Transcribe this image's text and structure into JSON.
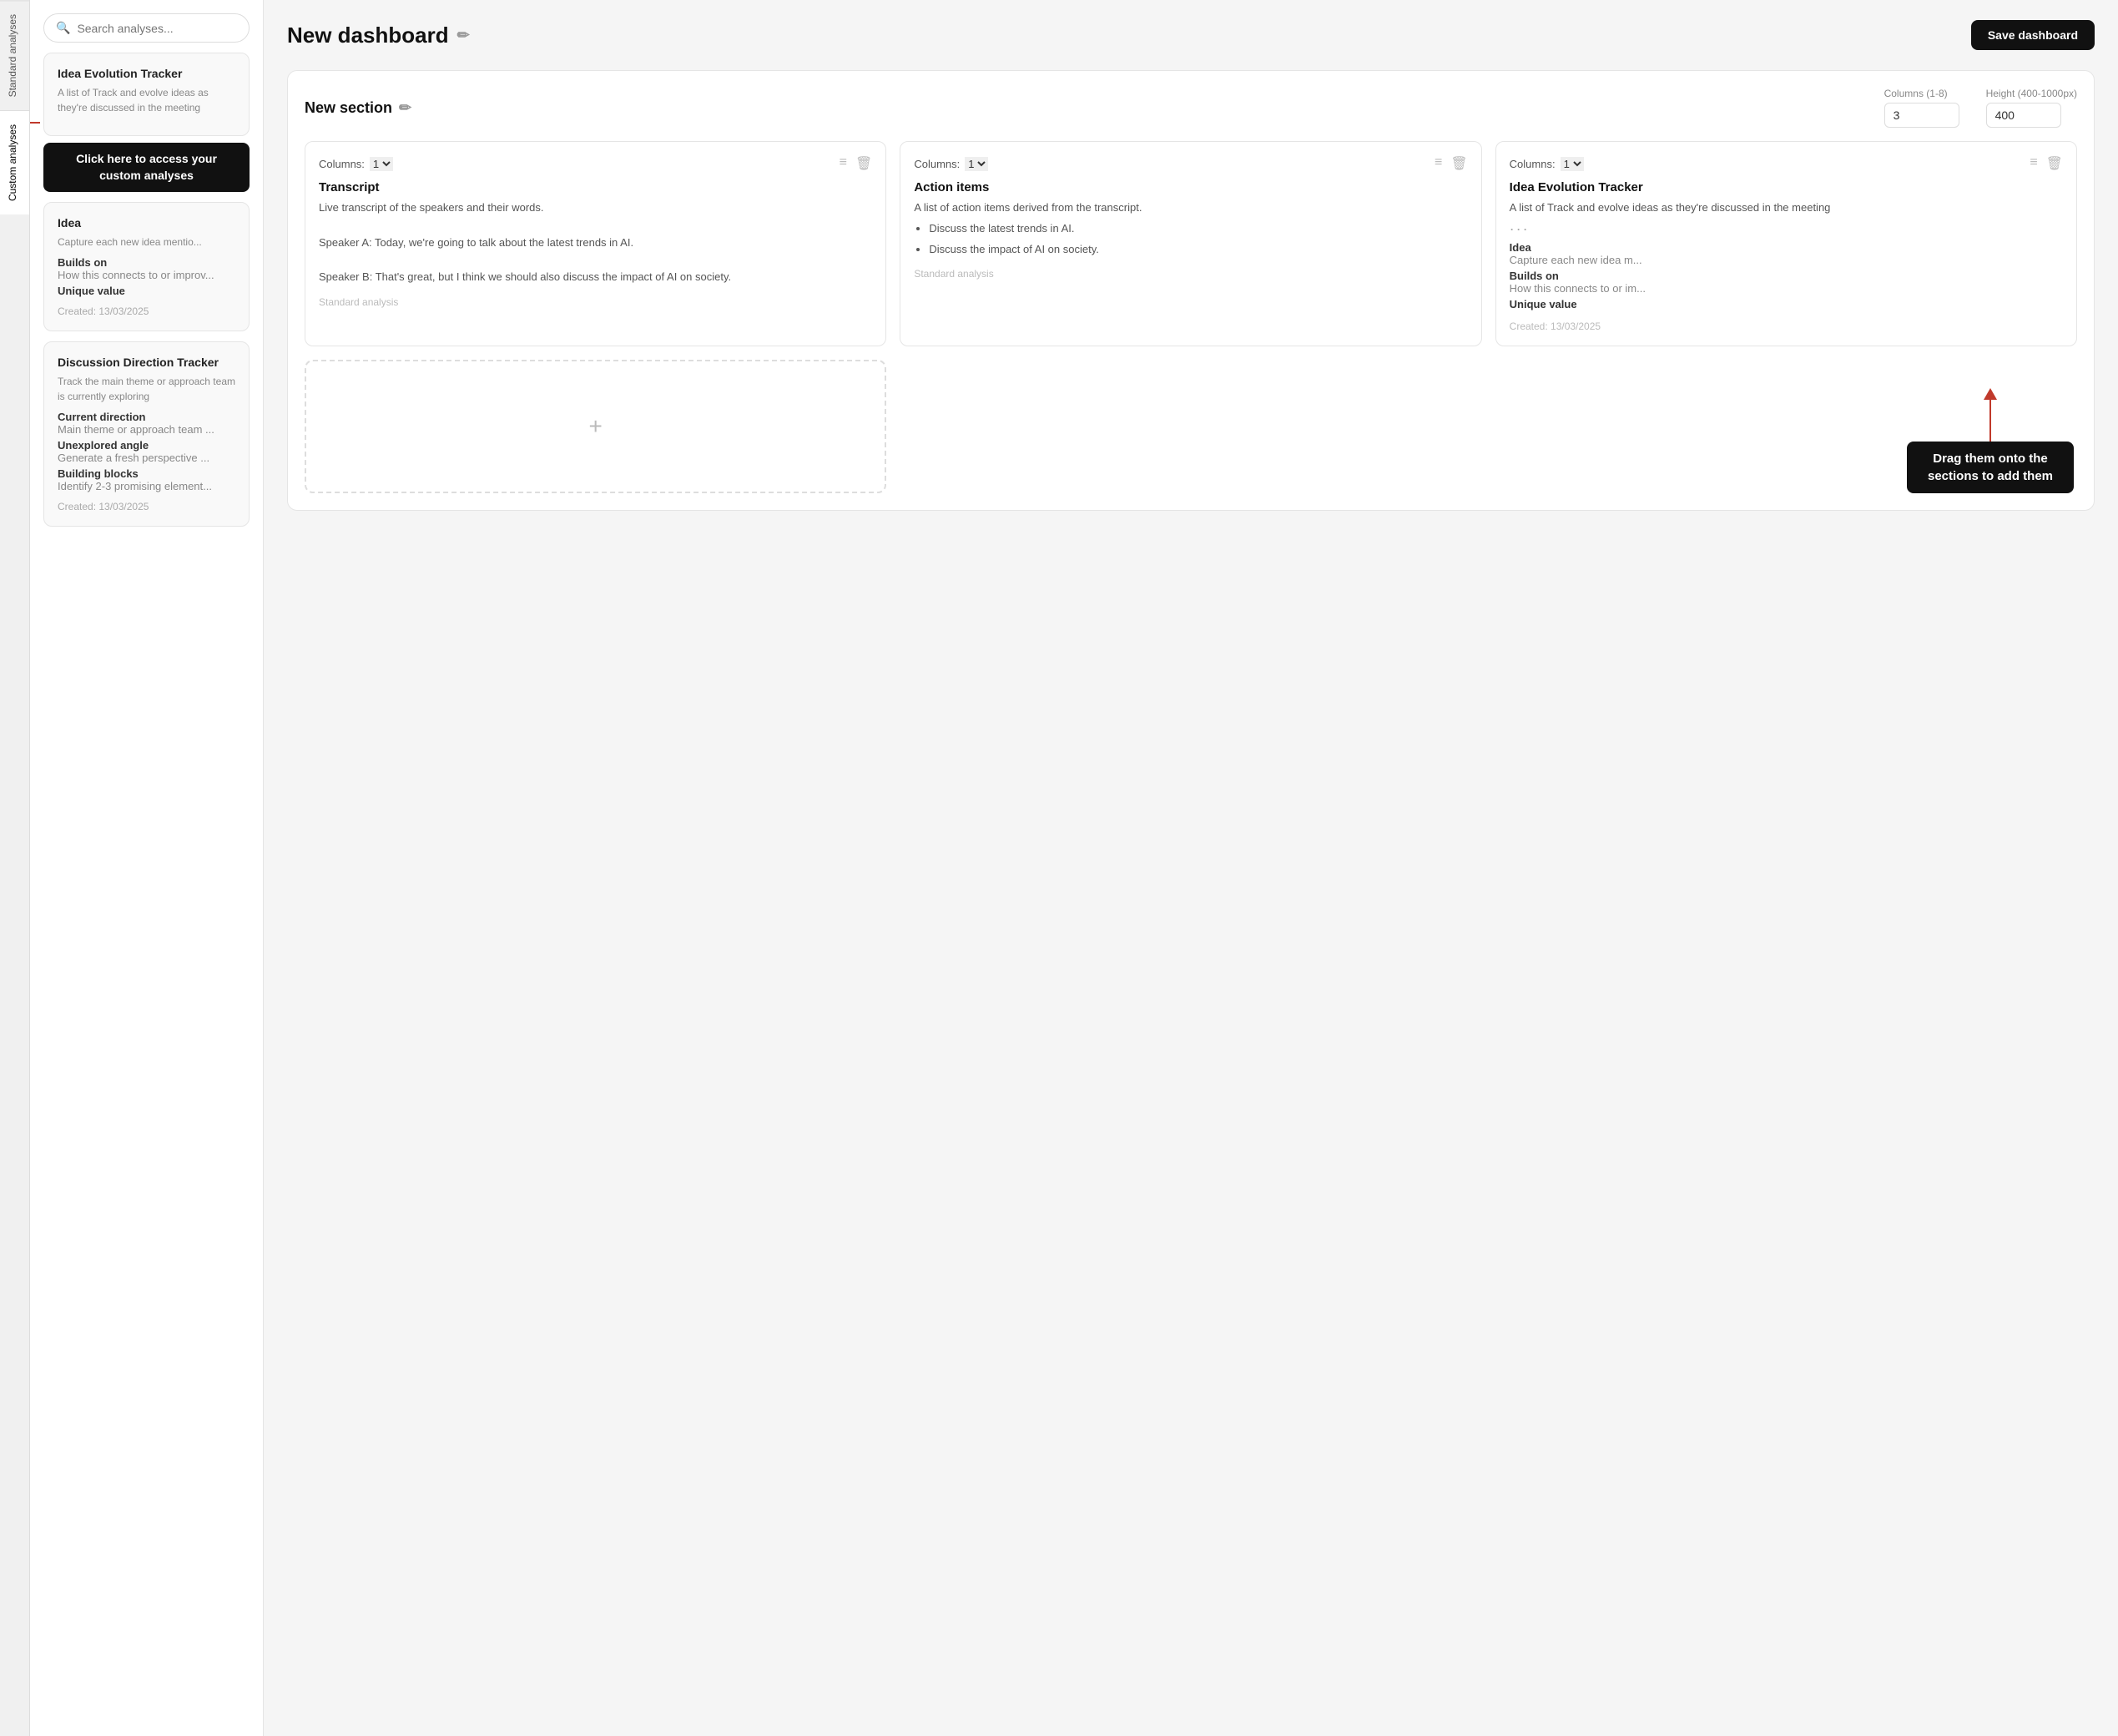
{
  "verticalTabs": [
    {
      "id": "standard",
      "label": "Standard analyses",
      "active": false
    },
    {
      "id": "custom",
      "label": "Custom analyses",
      "active": true
    }
  ],
  "sidebar": {
    "searchPlaceholder": "Search analyses...",
    "cards": [
      {
        "id": "idea-evolution-top",
        "title": "Idea Evolution Tracker",
        "description": "A list of Track and evolve ideas as they're discussed in the meeting",
        "fields": [],
        "date": null,
        "showDots": true,
        "tooltip": "Click here to access your custom analyses"
      },
      {
        "id": "idea-card",
        "title": "Idea",
        "description": "Capture each new idea mentio...",
        "fields": [
          {
            "label": "Builds on",
            "value": "How this connects to or improv..."
          },
          {
            "label": "Unique value",
            "value": ""
          }
        ],
        "date": "Created: 13/03/2025"
      },
      {
        "id": "discussion-direction",
        "title": "Discussion Direction Tracker",
        "description": "Track the main theme or approach team is currently exploring",
        "fields": [
          {
            "label": "Current direction",
            "value": "Main theme or approach team ..."
          },
          {
            "label": "Unexplored angle",
            "value": "Generate a fresh perspective ..."
          },
          {
            "label": "Building blocks",
            "value": "Identify 2-3 promising element..."
          }
        ],
        "date": "Created: 13/03/2025"
      }
    ]
  },
  "header": {
    "title": "New dashboard",
    "editIcon": "✏",
    "saveButton": "Save dashboard"
  },
  "section": {
    "title": "New section",
    "editIcon": "✏",
    "columnsLabel": "Columns (1-8)",
    "columnsValue": "3",
    "heightLabel": "Height (400-1000px)",
    "heightValue": "400"
  },
  "analysisBlocks": [
    {
      "id": "transcript",
      "columnsLabel": "Columns:",
      "columnsValue": "1",
      "title": "Transcript",
      "body": "Live transcript of the speakers and their words.\n\nSpeaker A: Today, we're going to talk about the latest trends in AI.\n\nSpeaker B: That's great, but I think we should also discuss the impact of AI on society.",
      "footer": "Standard analysis",
      "hasBullets": false
    },
    {
      "id": "action-items",
      "columnsLabel": "Columns:",
      "columnsValue": "1",
      "title": "Action items",
      "body": "A list of action items derived from the transcript.",
      "bullets": [
        "Discuss the latest trends in AI.",
        "Discuss the impact of AI on society."
      ],
      "footer": "Standard analysis",
      "hasBullets": true
    },
    {
      "id": "idea-evolution",
      "columnsLabel": "Columns:",
      "columnsValue": "1",
      "title": "Idea Evolution Tracker",
      "body": "A list of Track and evolve ideas as they're discussed in the meeting",
      "fields": [
        {
          "label": "Idea",
          "value": "Capture each new idea m..."
        },
        {
          "label": "Builds on",
          "value": "How this connects to or im..."
        },
        {
          "label": "Unique value",
          "value": ""
        }
      ],
      "footer": "Created: 13/03/2025",
      "hasBullets": false,
      "isCustom": true
    }
  ],
  "dropZone": {
    "icon": "+"
  },
  "annotations": {
    "clickTooltip": "Click here to access\nyour custom analyses",
    "dragTooltip": "Drag them onto the\nsections to add them"
  }
}
